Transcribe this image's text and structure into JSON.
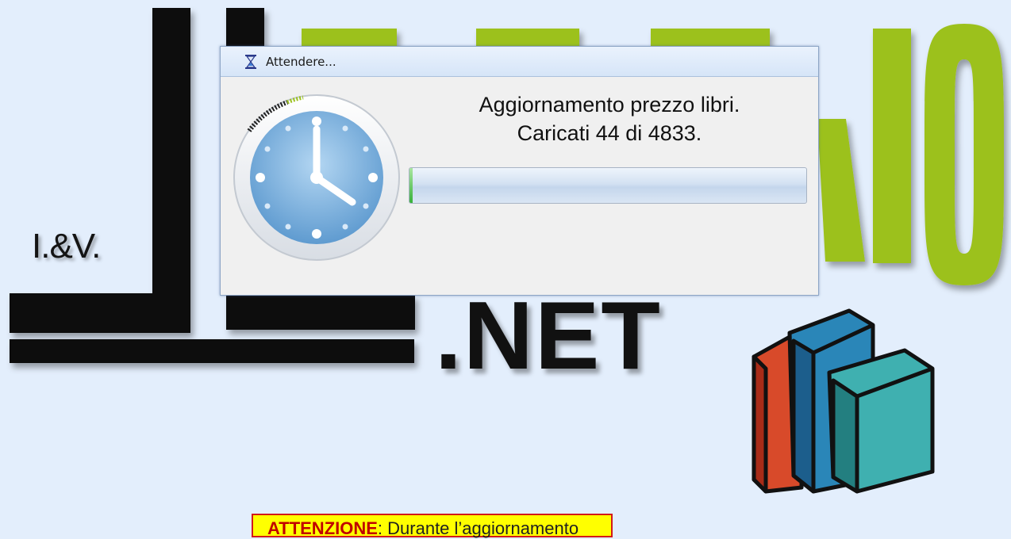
{
  "background": {
    "logo_prefix": "I.&V.",
    "logo_word": "LIBRAIO",
    "logo_suffix": ".NET"
  },
  "dialog": {
    "title": "Attendere...",
    "message_line1": "Aggiornamento prezzo libri.",
    "message_line2": "Caricati 44 di 4833.",
    "progress_fraction": 0.009,
    "title_icon": "hourglass-icon",
    "main_icon": "clock-icon"
  },
  "warning": {
    "label": "ATTENZIONE",
    "text": ": Durante l’aggiornamento"
  },
  "colors": {
    "accent_green": "#9cc11f",
    "background": "#e3eefc",
    "warning_bg": "#ffff00",
    "warning_border": "#d21a1a"
  }
}
